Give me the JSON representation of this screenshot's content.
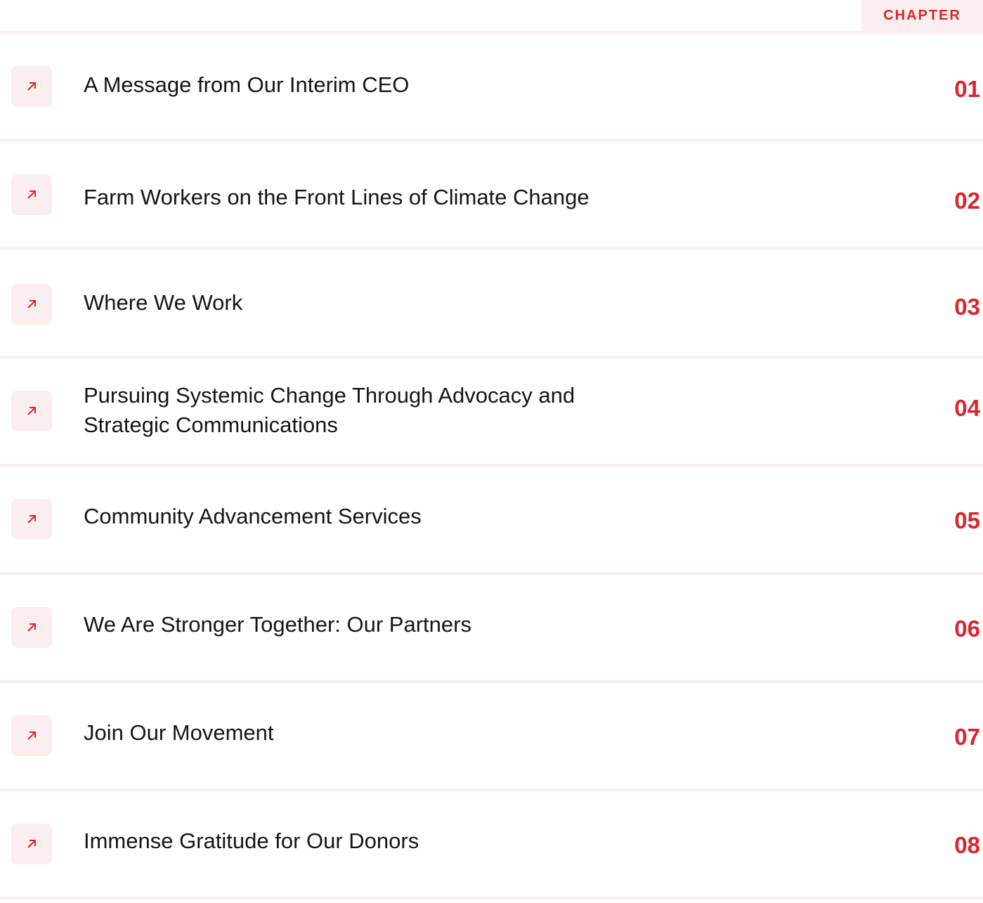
{
  "header": {
    "chapter_label": "CHAPTER"
  },
  "accent_color": "#d9262e",
  "divider_color": "#fbeeee",
  "chapters": [
    {
      "title": "A Message from Our Interim CEO",
      "number": "01",
      "icon": "arrow-up-right-icon"
    },
    {
      "title": "Farm Workers on the Front Lines of Climate Change",
      "number": "02",
      "icon": "arrow-up-right-icon"
    },
    {
      "title": "Where We Work",
      "number": "03",
      "icon": "arrow-up-right-icon"
    },
    {
      "title": "Pursuing Systemic Change Through Advocacy and Strategic Communications",
      "number": "04",
      "icon": "arrow-up-right-icon"
    },
    {
      "title": "Community Advancement Services",
      "number": "05",
      "icon": "arrow-up-right-icon"
    },
    {
      "title": "We Are Stronger Together: Our Partners",
      "number": "06",
      "icon": "arrow-up-right-icon"
    },
    {
      "title": "Join Our Movement",
      "number": "07",
      "icon": "arrow-up-right-icon"
    },
    {
      "title": "Immense Gratitude for Our Donors",
      "number": "08",
      "icon": "arrow-up-right-icon"
    }
  ]
}
